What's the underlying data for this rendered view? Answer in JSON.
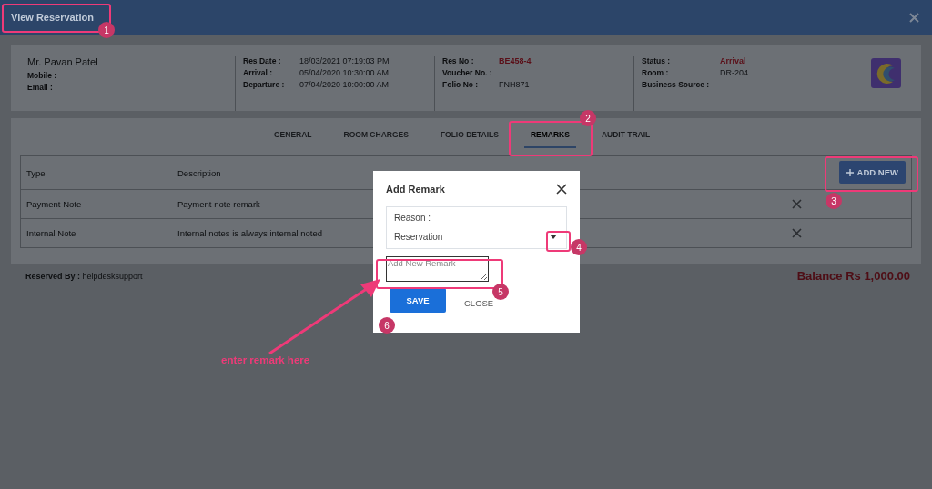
{
  "window": {
    "title": "View Reservation"
  },
  "guest": {
    "name": "Mr. Pavan Patel",
    "fields": [
      {
        "label": "Mobile :"
      },
      {
        "label": "Email :"
      }
    ]
  },
  "details": [
    {
      "fields": [
        {
          "label": "Res Date :",
          "value": "18/03/2021 07:19:03 PM",
          "highlight": false
        },
        {
          "label": "Arrival :",
          "value": "05/04/2020 10:30:00 AM",
          "highlight": false
        },
        {
          "label": "Departure :",
          "value": "07/04/2020 10:00:00 AM",
          "highlight": false
        }
      ]
    },
    {
      "fields": [
        {
          "label": "Res No :",
          "value": "BE458-4",
          "highlight": true
        },
        {
          "label": "Voucher No. :"
        },
        {
          "label": "Folio No :",
          "value": "FNH871",
          "highlight": false
        }
      ]
    },
    {
      "fields": [
        {
          "label": "Status :",
          "value": "Arrival",
          "highlight": true
        },
        {
          "label": "Room :",
          "value": "DR-204",
          "highlight": false
        },
        {
          "label": "Business Source :"
        }
      ]
    }
  ],
  "tabs": [
    {
      "label": "GENERAL",
      "selected": false
    },
    {
      "label": "ROOM CHARGES",
      "selected": false
    },
    {
      "label": "FOLIO DETAILS",
      "selected": false
    },
    {
      "label": "REMARKS",
      "selected": true
    },
    {
      "label": "AUDIT TRAIL",
      "selected": false
    }
  ],
  "table": {
    "columns": [
      "Type",
      "Description"
    ],
    "rows": [
      {
        "type": "Payment Note",
        "description": "Payment note remark"
      },
      {
        "type": "Internal Note",
        "description": "Internal notes is always internal noted"
      }
    ]
  },
  "add_new_button": "ADD NEW",
  "reserved_by": {
    "label": "Reserved By :",
    "value": "helpdesksupport"
  },
  "balance": "Balance Rs 1,000.00",
  "modal": {
    "title": "Add Remark",
    "reason_label": "Reason :",
    "reason_value": "Reservation",
    "remark_placeholder": "Add New Remark",
    "save_button": "SAVE",
    "close_button": "CLOSE"
  },
  "annotations": {
    "callouts": [
      "1",
      "2",
      "3",
      "4",
      "5",
      "6"
    ],
    "note": "enter remark here"
  }
}
